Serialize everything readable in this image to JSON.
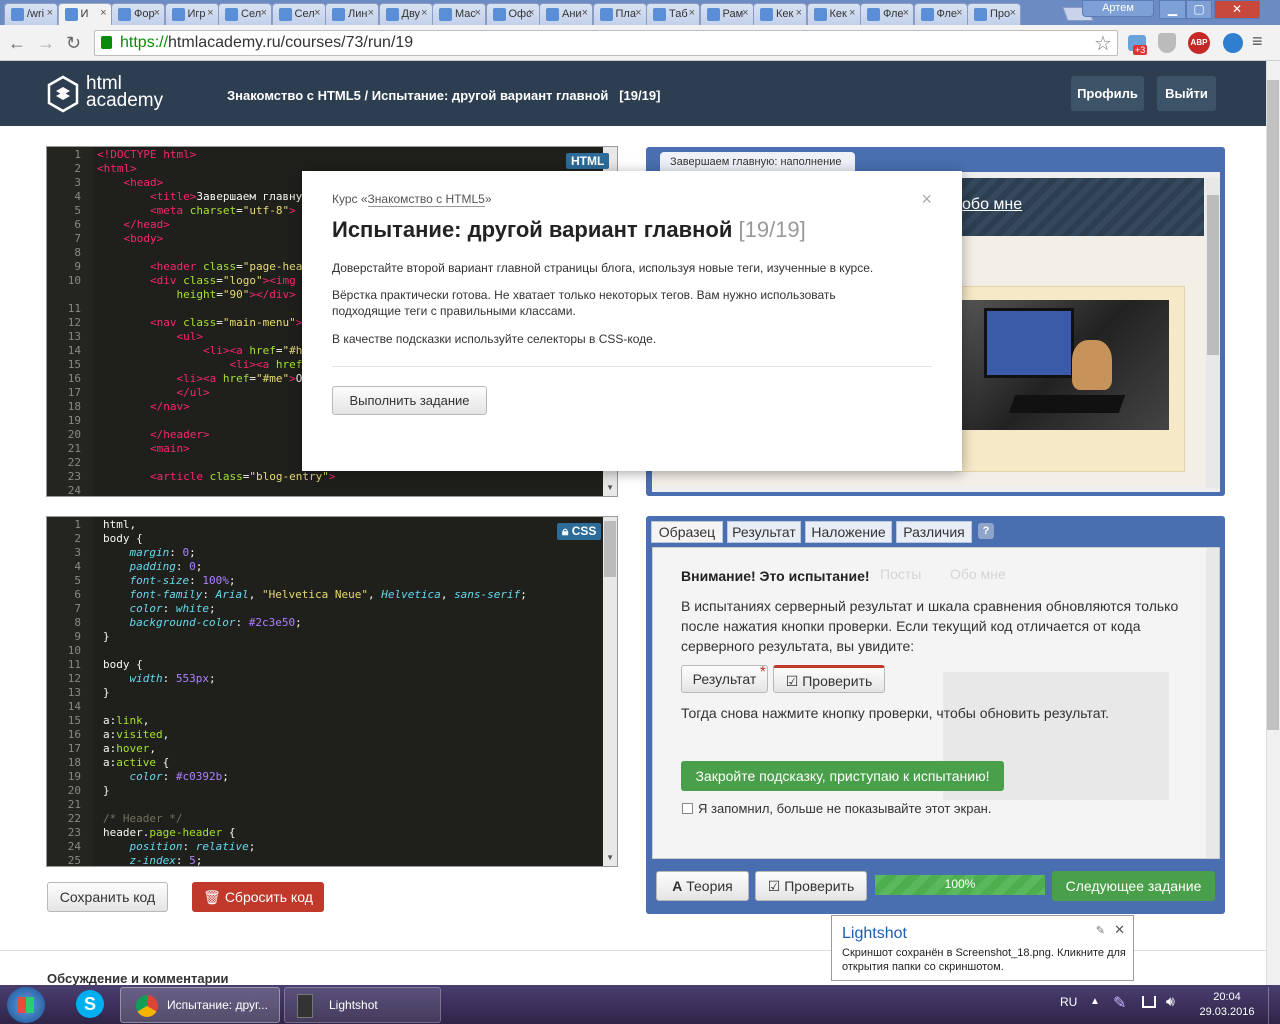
{
  "browser": {
    "tabs": [
      {
        "label": "/wri"
      },
      {
        "label": "И"
      },
      {
        "label": "Фор"
      },
      {
        "label": "Игр"
      },
      {
        "label": "Сел"
      },
      {
        "label": "Сел"
      },
      {
        "label": "Лин"
      },
      {
        "label": "Дву"
      },
      {
        "label": "Мас"
      },
      {
        "label": "Офс"
      },
      {
        "label": "Ани"
      },
      {
        "label": "Пла"
      },
      {
        "label": "Таб"
      },
      {
        "label": "Рам"
      },
      {
        "label": "Кек"
      },
      {
        "label": "Кек"
      },
      {
        "label": "Фле"
      },
      {
        "label": "Фле"
      },
      {
        "label": "Про"
      }
    ],
    "user": "Артем",
    "url_scheme": "https://",
    "url_rest": "htmlacademy.ru/courses/73/run/19",
    "ext_badge": "+3",
    "abp": "ABP"
  },
  "site": {
    "logo_line1": "html",
    "logo_line2": "academy",
    "crumb_course": "Знакомство с HTML5",
    "crumb_sep": "/",
    "crumb_task": "Испытание: другой вариант главной",
    "crumb_step": "[19/19]",
    "profile_btn": "Профиль",
    "logout_btn": "Выйти"
  },
  "html_editor": {
    "badge": "HTML",
    "line_numbers": "1\n2\n3\n4\n5\n6\n7\n8\n9\n10\n\n11\n12\n13\n14\n15\n16\n17\n18\n19\n20\n21\n22\n23\n24"
  },
  "css_editor": {
    "badge": "CSS",
    "line_numbers": "1\n2\n3\n4\n5\n6\n7\n8\n9\n10\n11\n12\n13\n14\n15\n16\n17\n18\n19\n20\n21\n22\n23\n24\n25"
  },
  "buttons": {
    "save": "Сохранить код",
    "reset": "Сбросить код"
  },
  "preview": {
    "tab_label": "Завершаем главную: наполнение ·",
    "nav_fragment": "обо мне"
  },
  "panel": {
    "tabs": [
      "Образец",
      "Результат",
      "Наложение",
      "Различия"
    ],
    "help": "?",
    "warn_title": "Внимание! Это испытание!",
    "warn_text": "В испытаниях серверный результат и шкала сравнения обновляются только после нажатия кнопки проверки. Если текущий код отличается от кода серверного результата, вы увидите:",
    "result_btn": "Результат",
    "check_btn": "Проверить",
    "then_text": "Тогда снова нажмите кнопку проверки, чтобы обновить результат.",
    "close_hint_btn": "Закройте подсказку, приступаю к испытанию!",
    "remember": "Я запомнил, больше не показывайте этот экран.",
    "ghost_nav1": "Посты",
    "ghost_nav2": "Обо мне",
    "theory_btn": "Теория",
    "check2_btn": "Проверить",
    "progress_label": "100%",
    "progress_value": 1.0,
    "next_btn": "Следующее задание"
  },
  "modal": {
    "course_prefix": "Курс «",
    "course_link": "Знакомство с HTML5",
    "course_suffix": "»",
    "title": "Испытание: другой вариант главной",
    "step": "[19/19]",
    "p1": "Доверстайте второй вариант главной страницы блога, используя новые теги, изученные в курсе.",
    "p2": "Вёрстка практически готова. Не хватает только некоторых тегов. Вам нужно использовать подходящие теги с правильными классами.",
    "p3": "В качестве подсказки используйте селекторы в CSS-коде.",
    "action_btn": "Выполнить задание",
    "close": "×"
  },
  "footer": {
    "discussion": "Обсуждение и комментарии"
  },
  "lightshot": {
    "title": "Lightshot",
    "text": "Скриншот сохранён в Screenshot_18.png. Кликните для открытия папки со скриншотом."
  },
  "taskbar": {
    "chrome_task": "Испытание: друг...",
    "lightshot_task": "Lightshot",
    "lang": "RU",
    "time": "20:04",
    "date": "29.03.2016"
  }
}
